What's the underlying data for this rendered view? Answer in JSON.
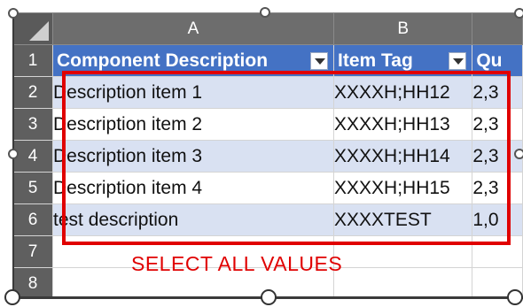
{
  "sheet": {
    "column_headers": [
      "A",
      "B",
      ""
    ],
    "row_numbers": [
      "1",
      "2",
      "3",
      "4",
      "5",
      "6",
      "7",
      "8"
    ],
    "table": {
      "headers": [
        "Component Description",
        "Item Tag",
        "Qu"
      ],
      "rows": [
        [
          "Description item 1",
          "XXXXH;HH12",
          "2,3"
        ],
        [
          "Description item 2",
          "XXXXH;HH13",
          "2,3"
        ],
        [
          "Description item 3",
          "XXXXH;HH14",
          "2,3"
        ],
        [
          "Description item 4",
          "XXXXH;HH15",
          "2,3"
        ],
        [
          "test description",
          "XXXXTEST",
          "1,0"
        ]
      ]
    }
  },
  "annotation": {
    "text": "SELECT ALL VALUES",
    "color": "#e00000"
  },
  "colors": {
    "header_fill": "#4472c4",
    "band_fill": "#d9e1f2",
    "grid_header_fill": "#6d6d6d"
  }
}
